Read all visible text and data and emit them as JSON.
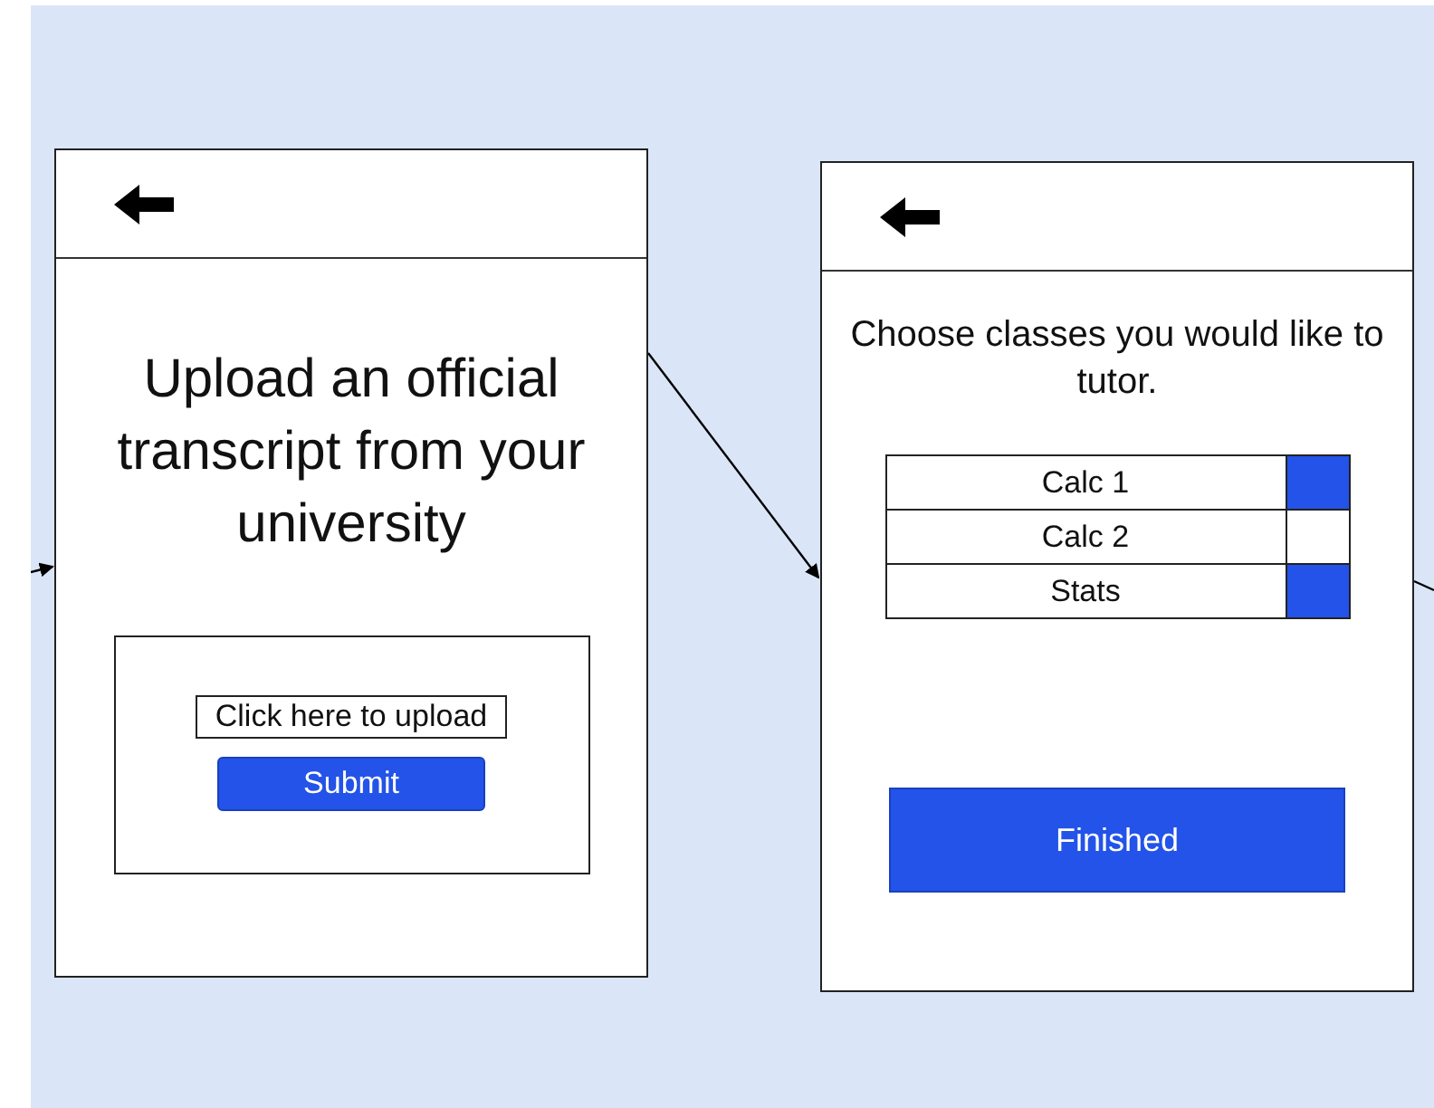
{
  "screens": [
    {
      "kind": "upload",
      "heading": "Upload an official transcript from your university",
      "upload_field": "Click here to upload",
      "button": "Submit"
    },
    {
      "kind": "classes",
      "heading": "Choose classes you would like to tutor.",
      "classes": [
        {
          "label": "Calc 1",
          "checked": true
        },
        {
          "label": "Calc 2",
          "checked": false
        },
        {
          "label": "Stats",
          "checked": true
        }
      ],
      "button": "Finished"
    }
  ]
}
